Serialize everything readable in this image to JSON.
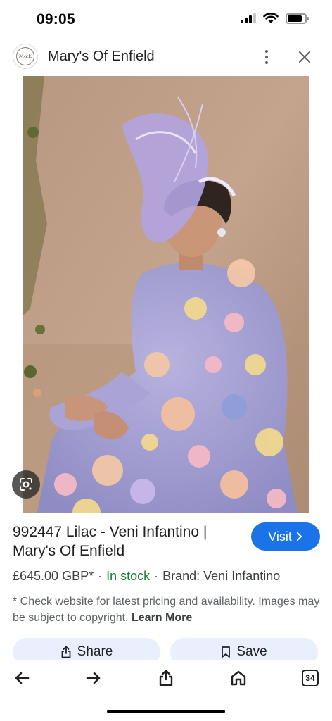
{
  "status_bar": {
    "time": "09:05",
    "battery_level": 0.85,
    "signal_bars": 3,
    "signal_max": 4
  },
  "header": {
    "logo_text": "M&E",
    "site_name": "Mary's Of Enfield",
    "more_icon": "more-vertical-icon",
    "close_icon": "close-icon"
  },
  "image": {
    "lens_icon": "lens-search-icon"
  },
  "product": {
    "title": "992447 Lilac - Veni Infantino | Mary's Of Enfield",
    "visit_label": "Visit",
    "price": "£645.00 GBP*",
    "stock": "In stock",
    "brand": "Brand: Veni Infantino",
    "disclaimer": "* Check website for latest pricing and availability. Images may be subject to copyright.",
    "learn_more": "Learn More",
    "share_label": "Share",
    "save_label": "Save"
  },
  "bottom_nav": {
    "back_icon": "arrow-left-icon",
    "forward_icon": "arrow-right-icon",
    "share_icon": "share-icon",
    "home_icon": "home-icon",
    "tab_count": "34"
  },
  "colors": {
    "accent": "#1a73e8",
    "stock_green": "#188038",
    "chip_bg": "#e8f0fe"
  }
}
